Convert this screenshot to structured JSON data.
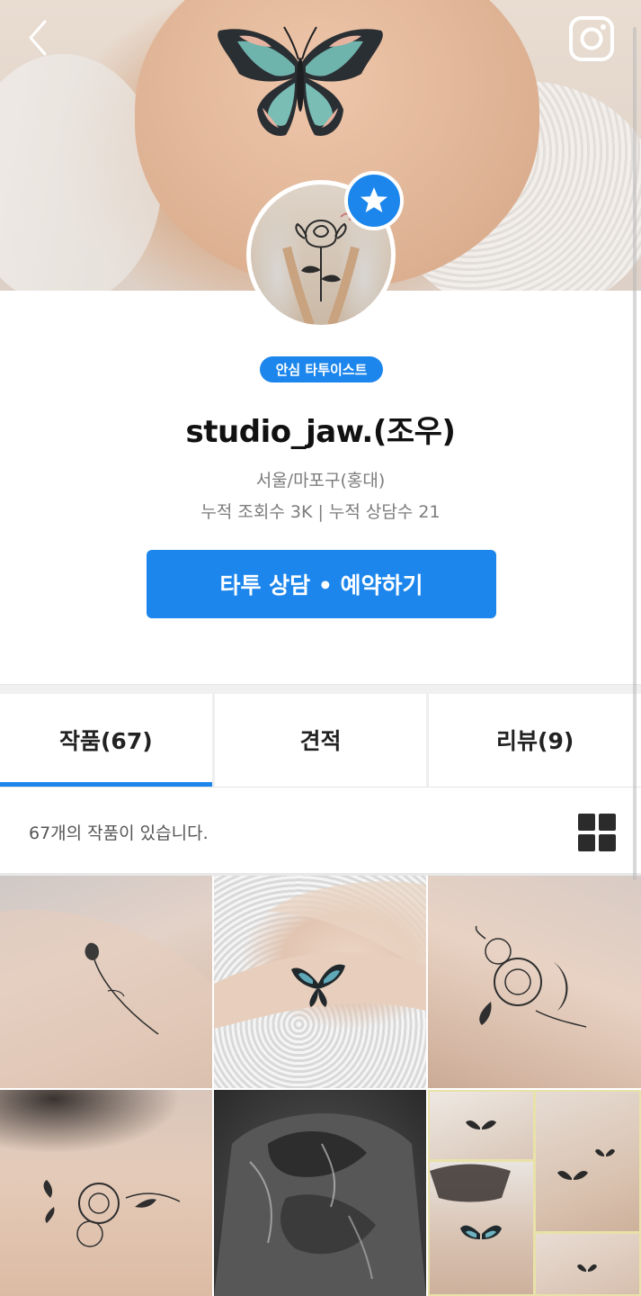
{
  "header": {
    "back_icon": "chevron-left-icon",
    "instagram_icon": "instagram-icon"
  },
  "profile": {
    "badge": "안심 타투이스트",
    "name": "studio_jaw.(조우)",
    "location": "서울/마포구(홍대)",
    "stats": "누적 조회수 3K | 누적 상담수 21",
    "cta_label": "타투 상담 • 예약하기",
    "star_icon": "star-icon"
  },
  "tabs": [
    {
      "label": "작품(67)",
      "active": true
    },
    {
      "label": "견적",
      "active": false
    },
    {
      "label": "리뷰(9)",
      "active": false
    }
  ],
  "works": {
    "count_text": "67개의 작품이 있습니다.",
    "view_icon": "grid-view-icon"
  },
  "colors": {
    "accent": "#1c86ec",
    "text_primary": "#111111",
    "text_secondary": "#7c7c7c"
  }
}
